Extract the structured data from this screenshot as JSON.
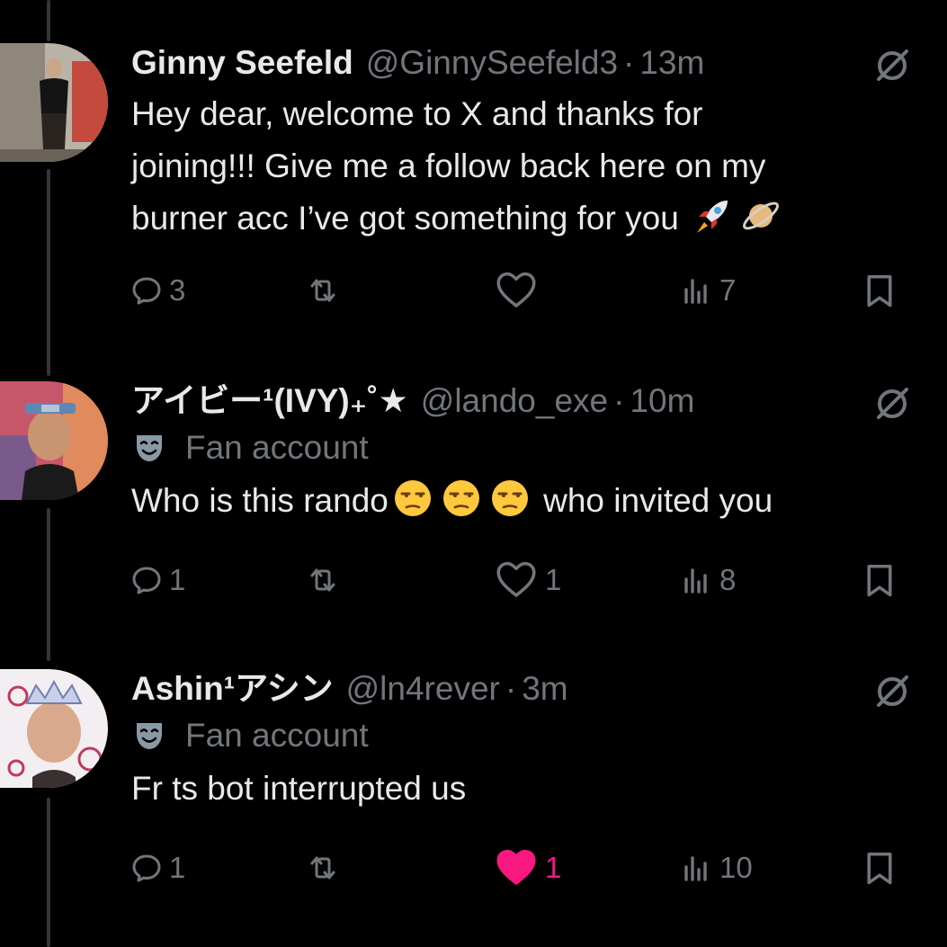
{
  "colors": {
    "background": "#000000",
    "text": "#e7e9ea",
    "muted": "#71767b",
    "thread_line": "#333639",
    "like_active": "#f91880"
  },
  "tweets": [
    {
      "display_name": "Ginny Seefeld",
      "handle": "@GinnySeefeld3",
      "separator": "·",
      "time": "13m",
      "fan_account": null,
      "text_lines": [
        "Hey dear, welcome to X and thanks for",
        "joining!!! Give me a follow back here on my",
        "burner acc I’ve got something for you"
      ],
      "emojis": [
        "rocket",
        "ringed-planet"
      ],
      "replies": "3",
      "reposts": "",
      "likes": "",
      "liked": false,
      "views": "7"
    },
    {
      "display_name": "アイビー¹(IVY)₊˚★",
      "handle": "@lando_exe",
      "separator": "·",
      "time": "10m",
      "fan_account": "Fan account",
      "text_before": "Who is this rando",
      "text_after": " who invited you",
      "emojis": [
        "unamused-face",
        "unamused-face",
        "unamused-face"
      ],
      "replies": "1",
      "reposts": "",
      "likes": "1",
      "liked": false,
      "views": "8"
    },
    {
      "display_name": "Ashin¹アシン",
      "handle": "@ln4rever",
      "separator": "·",
      "time": "3m",
      "fan_account": "Fan account",
      "text": "Fr ts bot interrupted us",
      "replies": "1",
      "reposts": "",
      "likes": "1",
      "liked": true,
      "views": "10"
    }
  ],
  "icons": {
    "reply": "reply-icon",
    "repost": "repost-icon",
    "like": "like-icon",
    "views": "views-icon",
    "bookmark": "bookmark-icon",
    "grok": "grok-icon",
    "fan": "theater-mask-icon"
  }
}
